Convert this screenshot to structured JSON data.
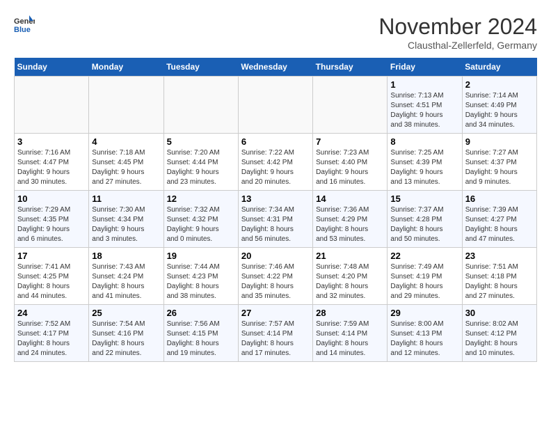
{
  "header": {
    "logo_general": "General",
    "logo_blue": "Blue",
    "month_title": "November 2024",
    "subtitle": "Clausthal-Zellerfeld, Germany"
  },
  "weekdays": [
    "Sunday",
    "Monday",
    "Tuesday",
    "Wednesday",
    "Thursday",
    "Friday",
    "Saturday"
  ],
  "weeks": [
    [
      {
        "day": "",
        "info": ""
      },
      {
        "day": "",
        "info": ""
      },
      {
        "day": "",
        "info": ""
      },
      {
        "day": "",
        "info": ""
      },
      {
        "day": "",
        "info": ""
      },
      {
        "day": "1",
        "info": "Sunrise: 7:13 AM\nSunset: 4:51 PM\nDaylight: 9 hours\nand 38 minutes."
      },
      {
        "day": "2",
        "info": "Sunrise: 7:14 AM\nSunset: 4:49 PM\nDaylight: 9 hours\nand 34 minutes."
      }
    ],
    [
      {
        "day": "3",
        "info": "Sunrise: 7:16 AM\nSunset: 4:47 PM\nDaylight: 9 hours\nand 30 minutes."
      },
      {
        "day": "4",
        "info": "Sunrise: 7:18 AM\nSunset: 4:45 PM\nDaylight: 9 hours\nand 27 minutes."
      },
      {
        "day": "5",
        "info": "Sunrise: 7:20 AM\nSunset: 4:44 PM\nDaylight: 9 hours\nand 23 minutes."
      },
      {
        "day": "6",
        "info": "Sunrise: 7:22 AM\nSunset: 4:42 PM\nDaylight: 9 hours\nand 20 minutes."
      },
      {
        "day": "7",
        "info": "Sunrise: 7:23 AM\nSunset: 4:40 PM\nDaylight: 9 hours\nand 16 minutes."
      },
      {
        "day": "8",
        "info": "Sunrise: 7:25 AM\nSunset: 4:39 PM\nDaylight: 9 hours\nand 13 minutes."
      },
      {
        "day": "9",
        "info": "Sunrise: 7:27 AM\nSunset: 4:37 PM\nDaylight: 9 hours\nand 9 minutes."
      }
    ],
    [
      {
        "day": "10",
        "info": "Sunrise: 7:29 AM\nSunset: 4:35 PM\nDaylight: 9 hours\nand 6 minutes."
      },
      {
        "day": "11",
        "info": "Sunrise: 7:30 AM\nSunset: 4:34 PM\nDaylight: 9 hours\nand 3 minutes."
      },
      {
        "day": "12",
        "info": "Sunrise: 7:32 AM\nSunset: 4:32 PM\nDaylight: 9 hours\nand 0 minutes."
      },
      {
        "day": "13",
        "info": "Sunrise: 7:34 AM\nSunset: 4:31 PM\nDaylight: 8 hours\nand 56 minutes."
      },
      {
        "day": "14",
        "info": "Sunrise: 7:36 AM\nSunset: 4:29 PM\nDaylight: 8 hours\nand 53 minutes."
      },
      {
        "day": "15",
        "info": "Sunrise: 7:37 AM\nSunset: 4:28 PM\nDaylight: 8 hours\nand 50 minutes."
      },
      {
        "day": "16",
        "info": "Sunrise: 7:39 AM\nSunset: 4:27 PM\nDaylight: 8 hours\nand 47 minutes."
      }
    ],
    [
      {
        "day": "17",
        "info": "Sunrise: 7:41 AM\nSunset: 4:25 PM\nDaylight: 8 hours\nand 44 minutes."
      },
      {
        "day": "18",
        "info": "Sunrise: 7:43 AM\nSunset: 4:24 PM\nDaylight: 8 hours\nand 41 minutes."
      },
      {
        "day": "19",
        "info": "Sunrise: 7:44 AM\nSunset: 4:23 PM\nDaylight: 8 hours\nand 38 minutes."
      },
      {
        "day": "20",
        "info": "Sunrise: 7:46 AM\nSunset: 4:22 PM\nDaylight: 8 hours\nand 35 minutes."
      },
      {
        "day": "21",
        "info": "Sunrise: 7:48 AM\nSunset: 4:20 PM\nDaylight: 8 hours\nand 32 minutes."
      },
      {
        "day": "22",
        "info": "Sunrise: 7:49 AM\nSunset: 4:19 PM\nDaylight: 8 hours\nand 29 minutes."
      },
      {
        "day": "23",
        "info": "Sunrise: 7:51 AM\nSunset: 4:18 PM\nDaylight: 8 hours\nand 27 minutes."
      }
    ],
    [
      {
        "day": "24",
        "info": "Sunrise: 7:52 AM\nSunset: 4:17 PM\nDaylight: 8 hours\nand 24 minutes."
      },
      {
        "day": "25",
        "info": "Sunrise: 7:54 AM\nSunset: 4:16 PM\nDaylight: 8 hours\nand 22 minutes."
      },
      {
        "day": "26",
        "info": "Sunrise: 7:56 AM\nSunset: 4:15 PM\nDaylight: 8 hours\nand 19 minutes."
      },
      {
        "day": "27",
        "info": "Sunrise: 7:57 AM\nSunset: 4:14 PM\nDaylight: 8 hours\nand 17 minutes."
      },
      {
        "day": "28",
        "info": "Sunrise: 7:59 AM\nSunset: 4:14 PM\nDaylight: 8 hours\nand 14 minutes."
      },
      {
        "day": "29",
        "info": "Sunrise: 8:00 AM\nSunset: 4:13 PM\nDaylight: 8 hours\nand 12 minutes."
      },
      {
        "day": "30",
        "info": "Sunrise: 8:02 AM\nSunset: 4:12 PM\nDaylight: 8 hours\nand 10 minutes."
      }
    ]
  ]
}
